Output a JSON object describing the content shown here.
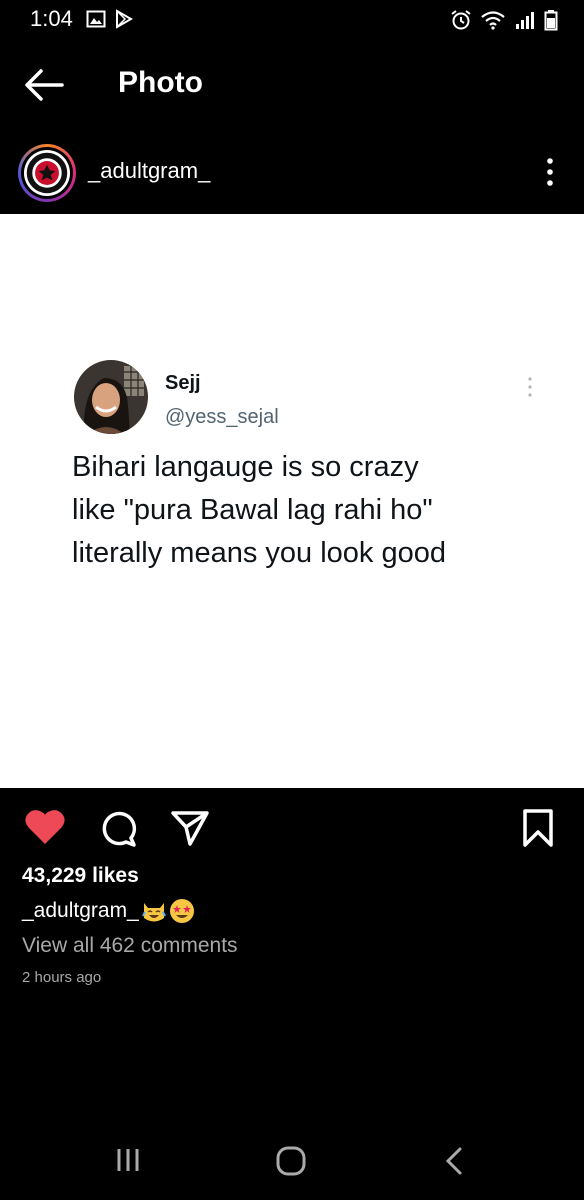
{
  "status_bar": {
    "time": "1:04",
    "left_icons": [
      "gallery-icon",
      "play-store-icon"
    ],
    "right_icons": [
      "alarm-icon",
      "wifi-icon",
      "signal-icon",
      "battery-icon"
    ]
  },
  "header": {
    "title": "Photo",
    "back_icon": "back-arrow-icon"
  },
  "post": {
    "username": "_adultgram_",
    "more_icon": "more-vertical-icon",
    "tweet": {
      "name": "Sejj",
      "handle": "@yess_sejal",
      "text": "Bihari langauge is so crazy\nlike \"pura Bawal lag rahi ho\"\nliterally means you look good"
    },
    "actions": {
      "like_icon": "heart-icon",
      "liked": true,
      "comment_icon": "comment-icon",
      "share_icon": "send-icon",
      "save_icon": "bookmark-icon"
    },
    "likes": "43,229 likes",
    "caption_user": "_adultgram_",
    "caption_emojis": [
      "laughing-cat-emoji",
      "star-struck-emoji"
    ],
    "view_comments": "View all 462 comments",
    "timestamp": "2 hours ago"
  },
  "colors": {
    "background": "#000000",
    "like_red": "#ed4956",
    "secondary_text": "#a8a8a8"
  },
  "nav_bar": {
    "buttons": [
      "recent-apps-icon",
      "home-icon",
      "back-icon"
    ]
  }
}
